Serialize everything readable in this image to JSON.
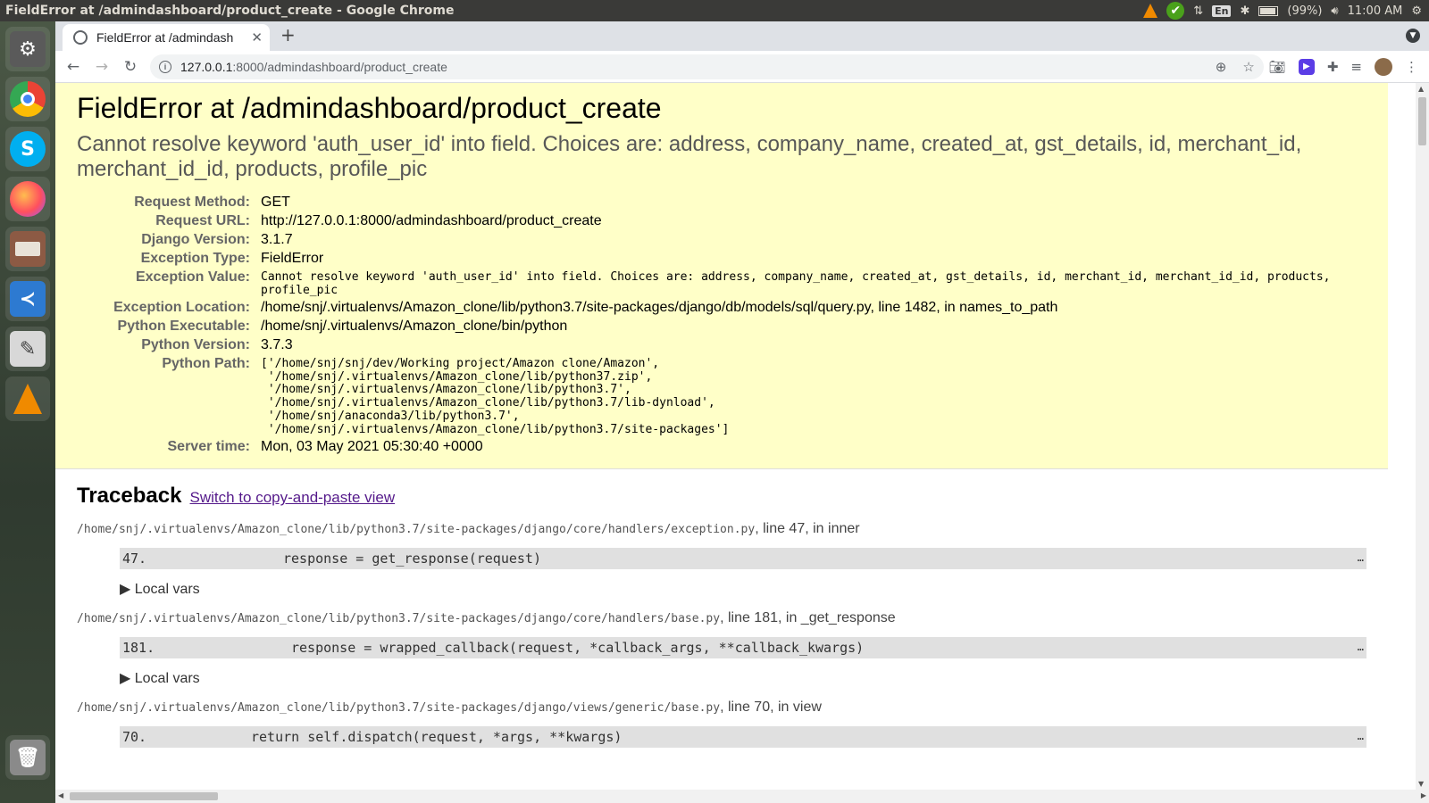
{
  "os": {
    "window_title": "FieldError at /admindashboard/product_create - Google Chrome",
    "tray": {
      "language": "En",
      "battery": "(99%)",
      "time": "11:00 AM"
    },
    "dock": [
      {
        "name": "ubuntu-software-icon",
        "color": "#5a5a5a"
      },
      {
        "name": "chrome-icon",
        "color": "#4285f4"
      },
      {
        "name": "skype-icon",
        "color": "#00aff0"
      },
      {
        "name": "firefox-icon",
        "color": "#ff7139"
      },
      {
        "name": "files-icon",
        "color": "#9a5a3c"
      },
      {
        "name": "vscode-icon",
        "color": "#2d7ad1"
      },
      {
        "name": "text-editor-icon",
        "color": "#d8d8d8"
      },
      {
        "name": "vlc-icon",
        "color": "#f08a00"
      },
      {
        "name": "trash-icon",
        "color": "#7a7a7a"
      }
    ]
  },
  "browser": {
    "tab_title": "FieldError at /admindash",
    "url_host": "127.0.0.1",
    "url_path": ":8000/admindashboard/product_create"
  },
  "error": {
    "title": "FieldError at /admindashboard/product_create",
    "message": "Cannot resolve keyword 'auth_user_id' into field. Choices are: address, company_name, created_at, gst_details, id, merchant_id, merchant_id_id, products, profile_pic",
    "meta": {
      "request_method_label": "Request Method:",
      "request_method": "GET",
      "request_url_label": "Request URL:",
      "request_url": "http://127.0.0.1:8000/admindashboard/product_create",
      "django_version_label": "Django Version:",
      "django_version": "3.1.7",
      "exception_type_label": "Exception Type:",
      "exception_type": "FieldError",
      "exception_value_label": "Exception Value:",
      "exception_value": "Cannot resolve keyword 'auth_user_id' into field. Choices are: address, company_name, created_at, gst_details, id, merchant_id, merchant_id_id, products, profile_pic",
      "exception_location_label": "Exception Location:",
      "exception_location": "/home/snj/.virtualenvs/Amazon_clone/lib/python3.7/site-packages/django/db/models/sql/query.py, line 1482, in names_to_path",
      "python_executable_label": "Python Executable:",
      "python_executable": "/home/snj/.virtualenvs/Amazon_clone/bin/python",
      "python_version_label": "Python Version:",
      "python_version": "3.7.3",
      "python_path_label": "Python Path:",
      "python_path": "['/home/snj/snj/dev/Working project/Amazon clone/Amazon',\n '/home/snj/.virtualenvs/Amazon_clone/lib/python37.zip',\n '/home/snj/.virtualenvs/Amazon_clone/lib/python3.7',\n '/home/snj/.virtualenvs/Amazon_clone/lib/python3.7/lib-dynload',\n '/home/snj/anaconda3/lib/python3.7',\n '/home/snj/.virtualenvs/Amazon_clone/lib/python3.7/site-packages']",
      "server_time_label": "Server time:",
      "server_time": "Mon, 03 May 2021 05:30:40 +0000"
    }
  },
  "traceback": {
    "heading": "Traceback",
    "switch_link": "Switch to copy-and-paste view",
    "local_vars_label": "▶ Local vars",
    "frames": [
      {
        "file": "/home/snj/.virtualenvs/Amazon_clone/lib/python3.7/site-packages/django/core/handlers/exception.py",
        "info": ", line 47, in inner",
        "line_no": "47.",
        "code": "response = get_response(request)"
      },
      {
        "file": "/home/snj/.virtualenvs/Amazon_clone/lib/python3.7/site-packages/django/core/handlers/base.py",
        "info": ", line 181, in _get_response",
        "line_no": "181.",
        "code": "response = wrapped_callback(request, *callback_args, **callback_kwargs)"
      },
      {
        "file": "/home/snj/.virtualenvs/Amazon_clone/lib/python3.7/site-packages/django/views/generic/base.py",
        "info": ", line 70, in view",
        "line_no": "70.",
        "code": "return self.dispatch(request, *args, **kwargs)"
      }
    ],
    "ellipsis": "…"
  }
}
